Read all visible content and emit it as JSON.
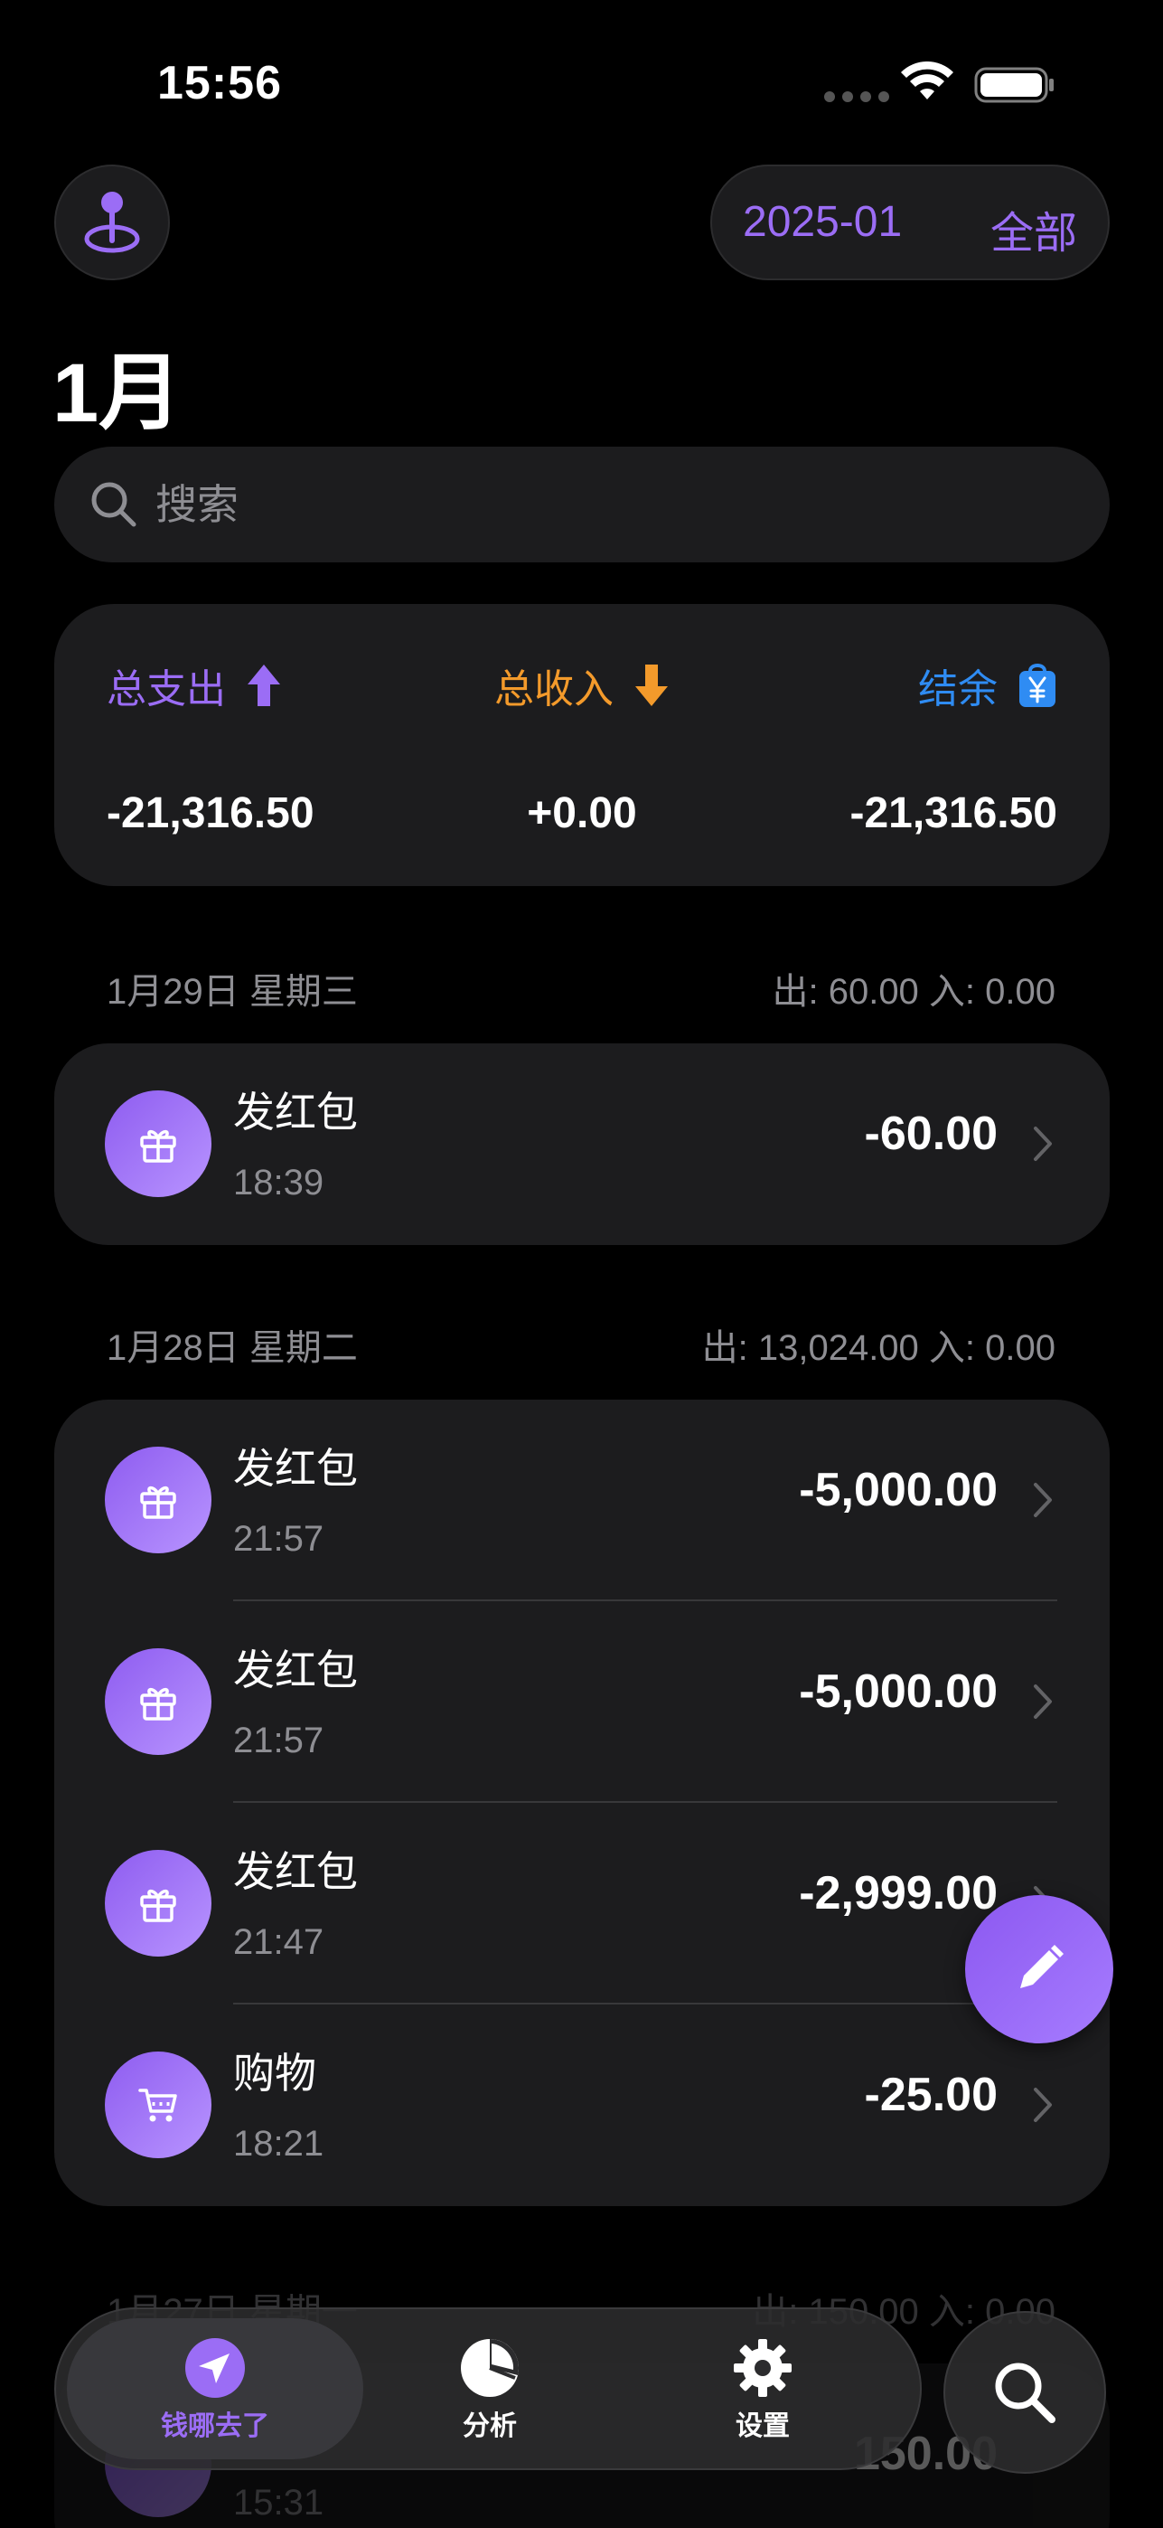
{
  "status_bar": {
    "time": "15:56"
  },
  "header": {
    "month_filter": "2025-01",
    "scope_filter": "全部"
  },
  "page_title": "1月",
  "search": {
    "placeholder": "搜索"
  },
  "summary": {
    "expense_label": "总支出",
    "expense_value": "-21,316.50",
    "income_label": "总收入",
    "income_value": "+0.00",
    "balance_label": "结余",
    "balance_value": "-21,316.50",
    "colors": {
      "expense": "#9b6df5",
      "income": "#f39a2b",
      "balance": "#2f8cf3"
    }
  },
  "days": [
    {
      "date": "1月29日 星期三",
      "totals": "出:  60.00   入:  0.00",
      "items": [
        {
          "icon": "gift-icon",
          "name": "发红包",
          "time": "18:39",
          "amount": "-60.00"
        }
      ]
    },
    {
      "date": "1月28日 星期二",
      "totals": "出:  13,024.00   入:  0.00",
      "items": [
        {
          "icon": "gift-icon",
          "name": "发红包",
          "time": "21:57",
          "amount": "-5,000.00"
        },
        {
          "icon": "gift-icon",
          "name": "发红包",
          "time": "21:57",
          "amount": "-5,000.00"
        },
        {
          "icon": "gift-icon",
          "name": "发红包",
          "time": "21:47",
          "amount": "-2,999.00"
        },
        {
          "icon": "cart-icon",
          "name": "购物",
          "time": "18:21",
          "amount": "-25.00"
        }
      ]
    },
    {
      "date": "1月27日 星期一",
      "totals": "出:  150.00   入:  0.00",
      "items": [
        {
          "icon": "gift-icon",
          "name": "",
          "time": "15:31",
          "amount": "150.00"
        }
      ]
    }
  ],
  "tab_bar": {
    "tabs": [
      {
        "label": "钱哪去了",
        "icon": "navigation-arrow-icon",
        "active": true
      },
      {
        "label": "分析",
        "icon": "pie-chart-icon",
        "active": false
      },
      {
        "label": "设置",
        "icon": "gear-icon",
        "active": false
      }
    ]
  },
  "accent_color": "#9b6df5"
}
